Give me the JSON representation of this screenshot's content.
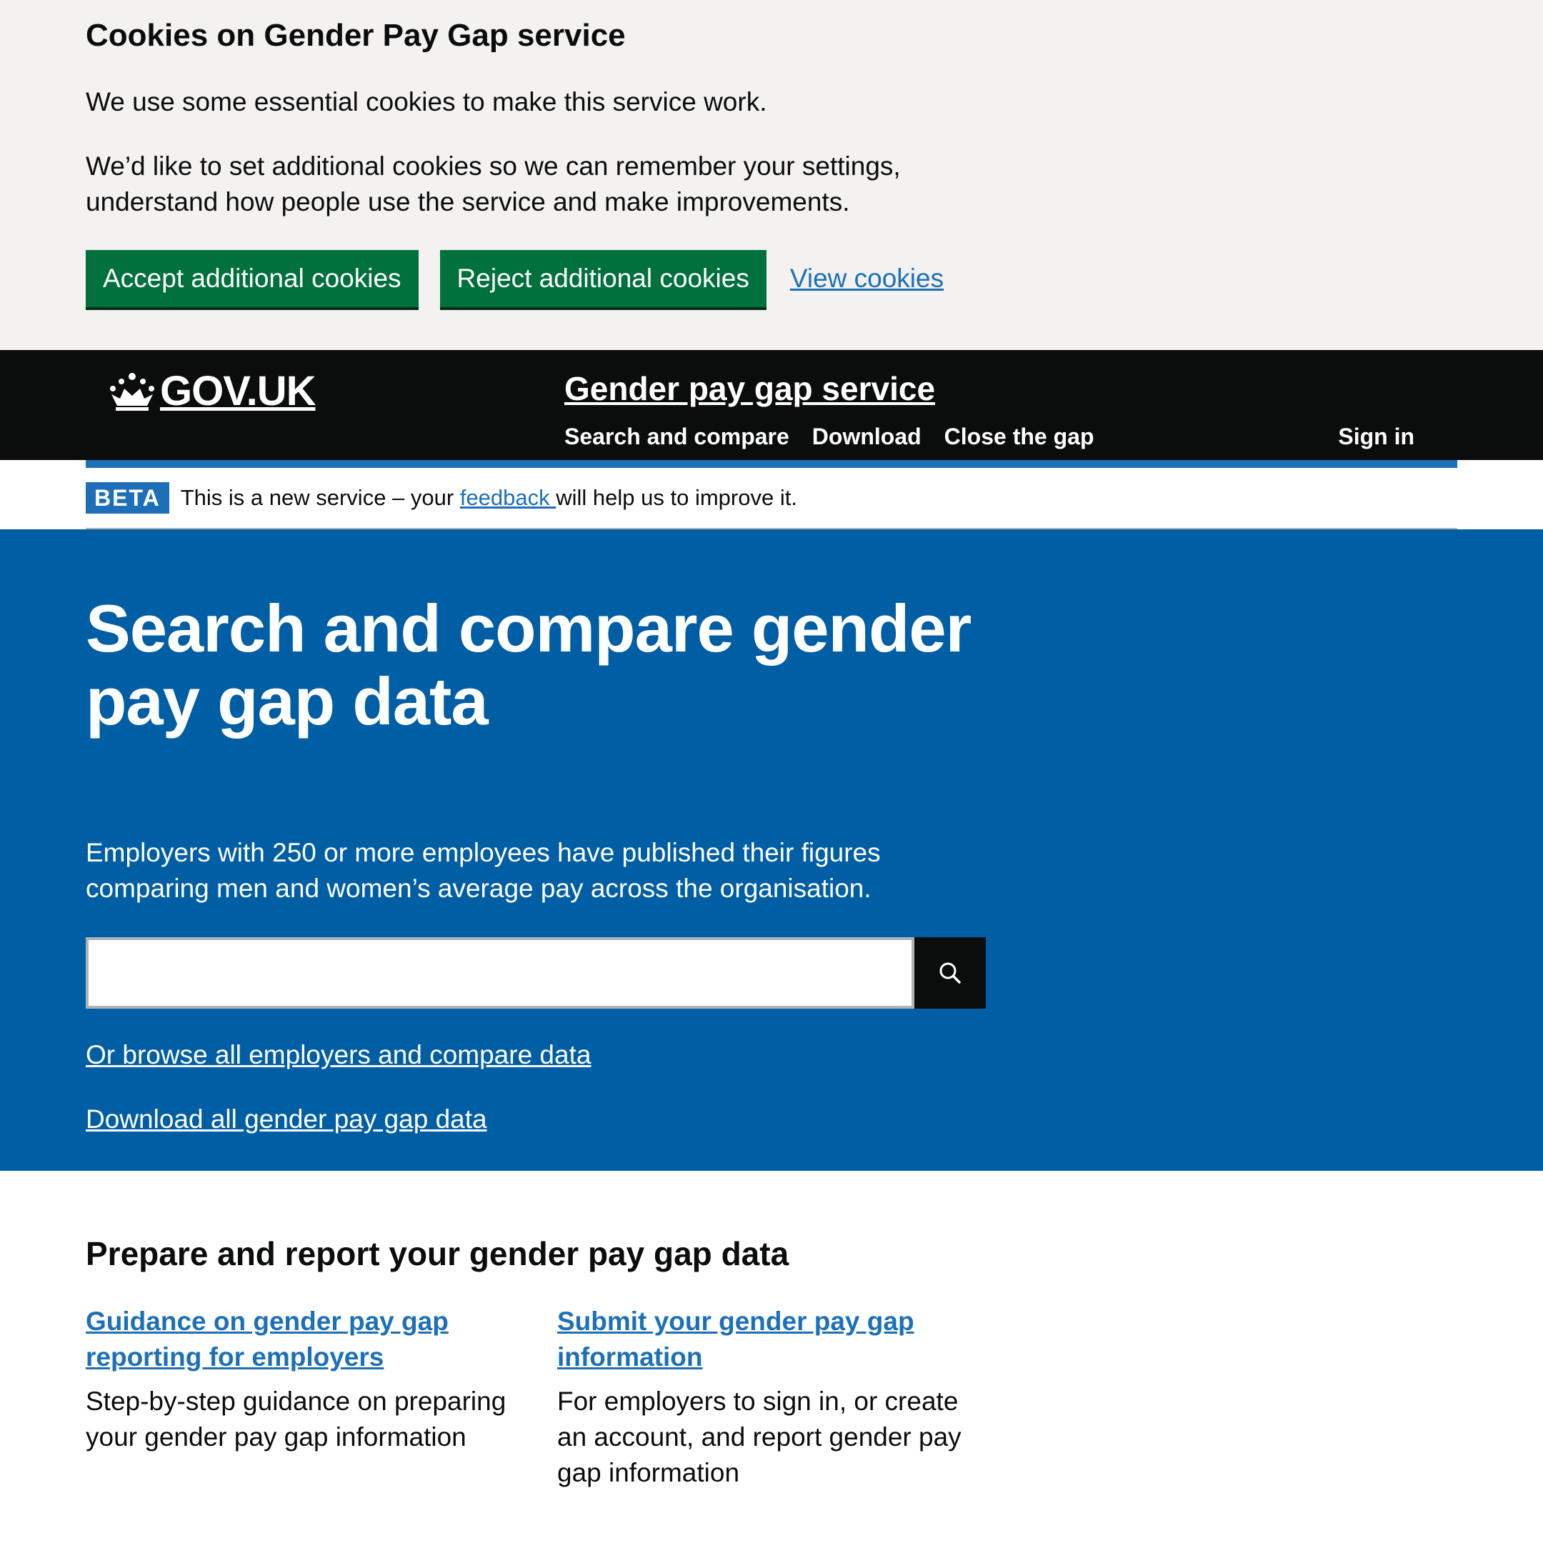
{
  "cookie_banner": {
    "title": "Cookies on Gender Pay Gap service",
    "paragraph_1": "We use some essential cookies to make this service work.",
    "paragraph_2": "We’d like to set additional cookies so we can remember your settings, understand how people use the service and make improvements.",
    "accept_label": "Accept additional cookies",
    "reject_label": "Reject additional cookies",
    "view_label": "View cookies"
  },
  "header": {
    "logo_text": "GOV.UK",
    "service_name": "Gender pay gap service",
    "nav": [
      {
        "label": "Search and compare"
      },
      {
        "label": "Download"
      },
      {
        "label": "Close the gap"
      }
    ],
    "sign_in": "Sign in"
  },
  "phase_banner": {
    "tag": "BETA",
    "text_before": "This is a new service – your ",
    "link": "feedback ",
    "text_after": "will help us to improve it."
  },
  "hero": {
    "title": "Search and compare gender pay gap data",
    "description": "Employers with 250 or more employees have published their figures comparing men and women’s average pay across the organisation.",
    "search_value": "",
    "search_icon": "magnifying-glass",
    "browse_link": "Or browse all employers and compare data",
    "download_link": "Download all gender pay gap data"
  },
  "prepare": {
    "heading": "Prepare and report your gender pay gap data",
    "cards": [
      {
        "link": "Guidance on gender pay gap reporting for employers",
        "description": "Step-by-step guidance on preparing your gender pay gap information"
      },
      {
        "link": "Submit your gender pay gap information",
        "description": "For employers to sign in, or create an account, and report gender pay gap information"
      }
    ]
  },
  "colors": {
    "brand_blue": "#1d70b8",
    "hero_blue": "#005ea5",
    "button_green": "#00703c",
    "header_black": "#0b0c0c",
    "banner_grey": "#f3f2f1"
  }
}
